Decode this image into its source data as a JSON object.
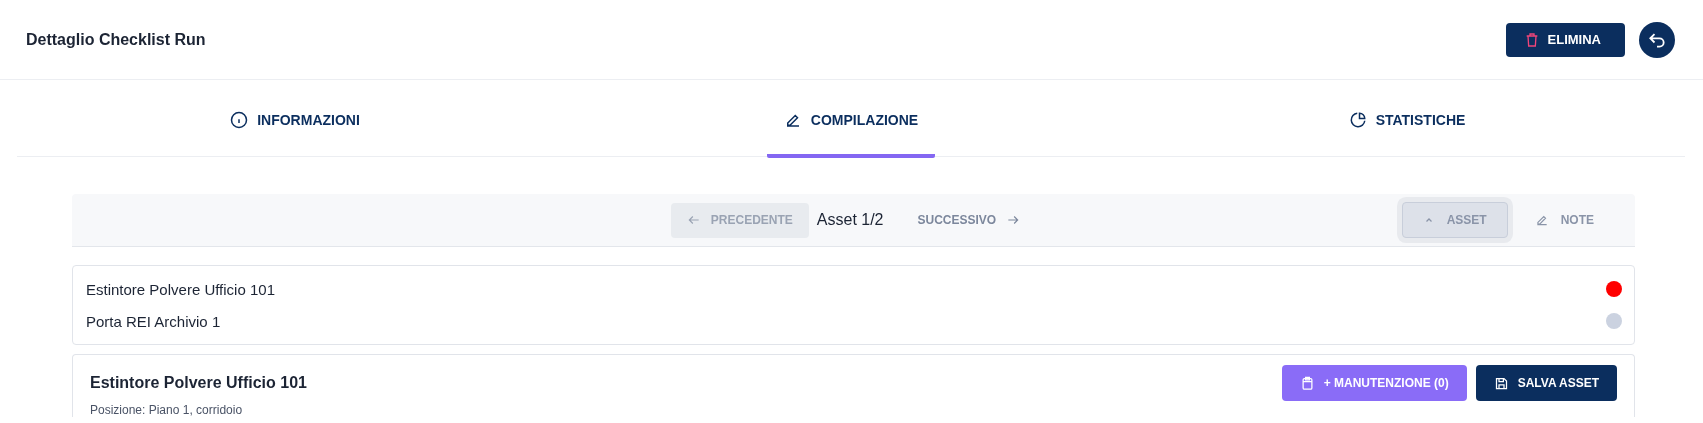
{
  "header": {
    "title": "Dettaglio Checklist Run",
    "delete_button": "ELIMINA"
  },
  "tabs": [
    {
      "label": "INFORMAZIONI",
      "kind": "info",
      "selected": false
    },
    {
      "label": "COMPILAZIONE",
      "kind": "pencil",
      "selected": true
    },
    {
      "label": "STATISTICHE",
      "kind": "pie",
      "selected": false
    }
  ],
  "toolbar": {
    "previous": {
      "label": "PRECEDENTE",
      "disabled": true
    },
    "position": "Asset 1/2",
    "next": {
      "label": "SUCCESSIVO",
      "disabled": false
    },
    "toggles": [
      {
        "label": "ASSET",
        "kind": "chevron",
        "selected": true
      },
      {
        "label": "NOTE",
        "kind": "pencil",
        "selected": false
      }
    ]
  },
  "assets": [
    {
      "name": "Estintore Polvere Ufficio 101",
      "color": "#ff0000"
    },
    {
      "name": "Porta REI Archivio 1",
      "color": "#cbd2e0"
    }
  ],
  "detail": {
    "title": "Estintore Polvere Ufficio 101",
    "maintenance_button": "+ MANUTENZIONE (0)",
    "save_button": "SALVA ASSET",
    "location": "Posizione: Piano 1, corridoio"
  }
}
